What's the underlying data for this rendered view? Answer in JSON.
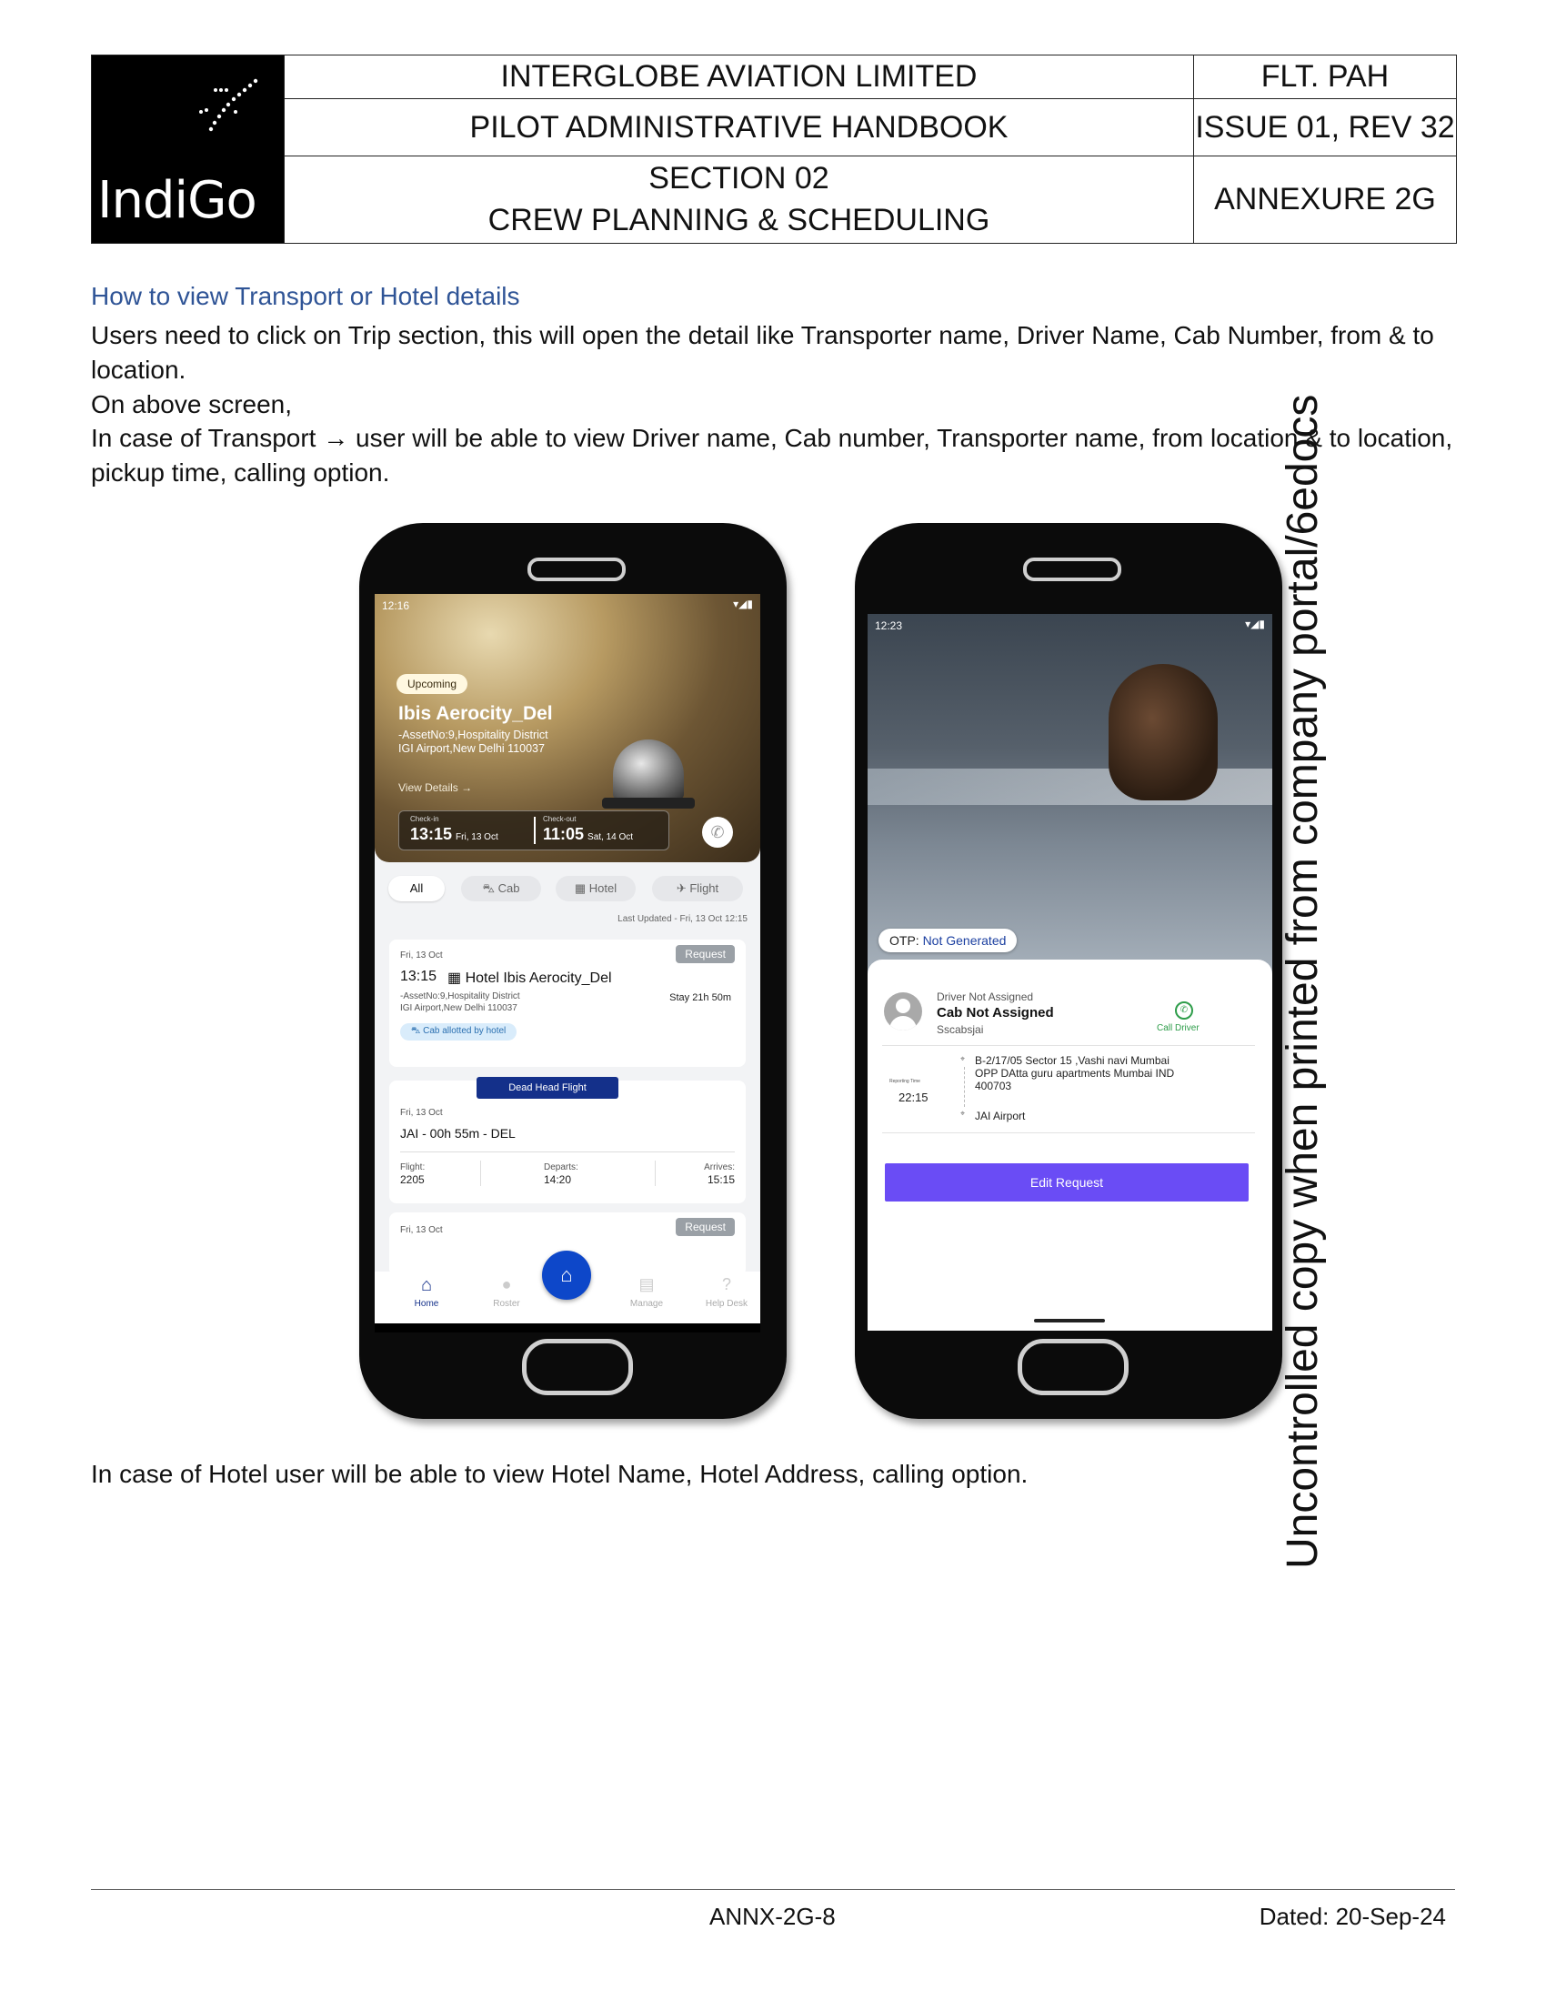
{
  "header": {
    "logo_text": "IndiGo",
    "company": "INTERGLOBE AVIATION LIMITED",
    "code": "FLT. PAH",
    "handbook": "PILOT ADMINISTRATIVE HANDBOOK",
    "issue": "ISSUE 01, REV 32",
    "section_line1": "SECTION 02",
    "section_line2": "CREW PLANNING & SCHEDULING",
    "annexure": "ANNEXURE 2G"
  },
  "content": {
    "heading": "How to view Transport or Hotel details",
    "p1": "Users need to click on Trip section, this will open the detail like Transporter name, Driver Name, Cab Number, from & to location.",
    "p2": "On above screen,",
    "p3": "In case of Transport → user will be able to view Driver name, Cab number, Transporter name, from location & to location, pickup time, calling option.",
    "p4": "In case of Hotel user will be able to view Hotel Name, Hotel Address, calling option."
  },
  "phone1": {
    "time": "12:16",
    "status_pill": "Upcoming",
    "hotel_name": "Ibis Aerocity_Del",
    "address_line1": "-AssetNo:9,Hospitality District",
    "address_line2": "IGI Airport,New Delhi 110037",
    "view_details": "View Details →",
    "checkin_label": "Check-in",
    "checkin_time": "13:15",
    "checkin_date": "Fri, 13 Oct",
    "checkout_label": "Check-out",
    "checkout_time": "11:05",
    "checkout_date": "Sat, 14 Oct",
    "tabs": [
      "All",
      "Cab",
      "Hotel",
      "Flight"
    ],
    "last_updated": "Last Updated - Fri, 13 Oct 12:15",
    "card1": {
      "date": "Fri, 13 Oct",
      "request": "Request",
      "time": "13:15",
      "hotel": "Hotel Ibis Aerocity_Del",
      "addr1": "-AssetNo:9,Hospitality District",
      "addr2": "IGI Airport,New Delhi 110037",
      "stay": "Stay 21h 50m",
      "cab_badge": "Cab allotted by hotel"
    },
    "card2": {
      "banner": "Dead Head Flight",
      "date": "Fri, 13 Oct",
      "route": "JAI - 00h 55m - DEL",
      "flight_label": "Flight:",
      "flight": "2205",
      "departs_label": "Departs:",
      "departs": "14:20",
      "arrives_label": "Arrives:",
      "arrives": "15:15"
    },
    "card3": {
      "date": "Fri, 13 Oct",
      "request": "Request"
    },
    "nav": [
      "Home",
      "Roster",
      "Manage",
      "Help Desk"
    ]
  },
  "phone2": {
    "time": "12:23",
    "otp_label": "OTP:",
    "otp_value": "Not Generated",
    "driver_status": "Driver Not Assigned",
    "cab_status": "Cab Not Assigned",
    "transporter": "Sscabsjai",
    "call_driver": "Call Driver",
    "reporting_label": "Reporting Time",
    "reporting_time": "22:15",
    "from_line1": "B-2/17/05 Sector 15 ,Vashi navi Mumbai",
    "from_line2": "OPP DAtta guru apartments Mumbai IND",
    "from_line3": "400703",
    "to": "JAI Airport",
    "edit_request": "Edit Request"
  },
  "watermark": "Uncontrolled copy when printed from company portal/6edocs",
  "footer": {
    "page": "ANNX-2G-8",
    "dated": "Dated: 20-Sep-24"
  },
  "colors": {
    "heading": "#2f5496",
    "edit_button": "#6a4cf5",
    "nav_active": "#14308a"
  }
}
